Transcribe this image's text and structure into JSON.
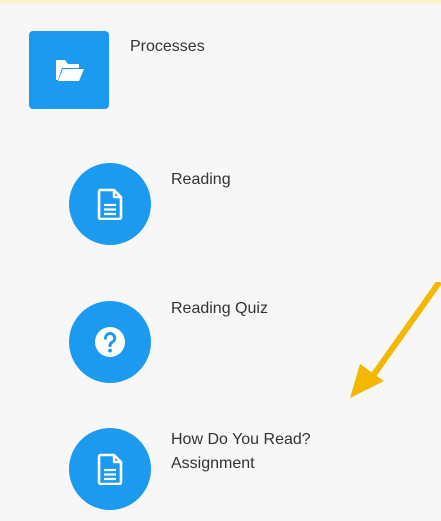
{
  "module": {
    "title": "Processes",
    "icon": "folder-open-icon"
  },
  "items": [
    {
      "label": "Reading",
      "icon": "document-icon"
    },
    {
      "label": "Reading Quiz",
      "icon": "question-icon"
    },
    {
      "label_line1": "How Do You Read?",
      "label_line2": "Assignment",
      "icon": "document-icon"
    }
  ],
  "colors": {
    "accent": "#1b9af0",
    "text": "#333333",
    "annotation_arrow": "#f5b800",
    "top_border": "#fdf3cc"
  }
}
